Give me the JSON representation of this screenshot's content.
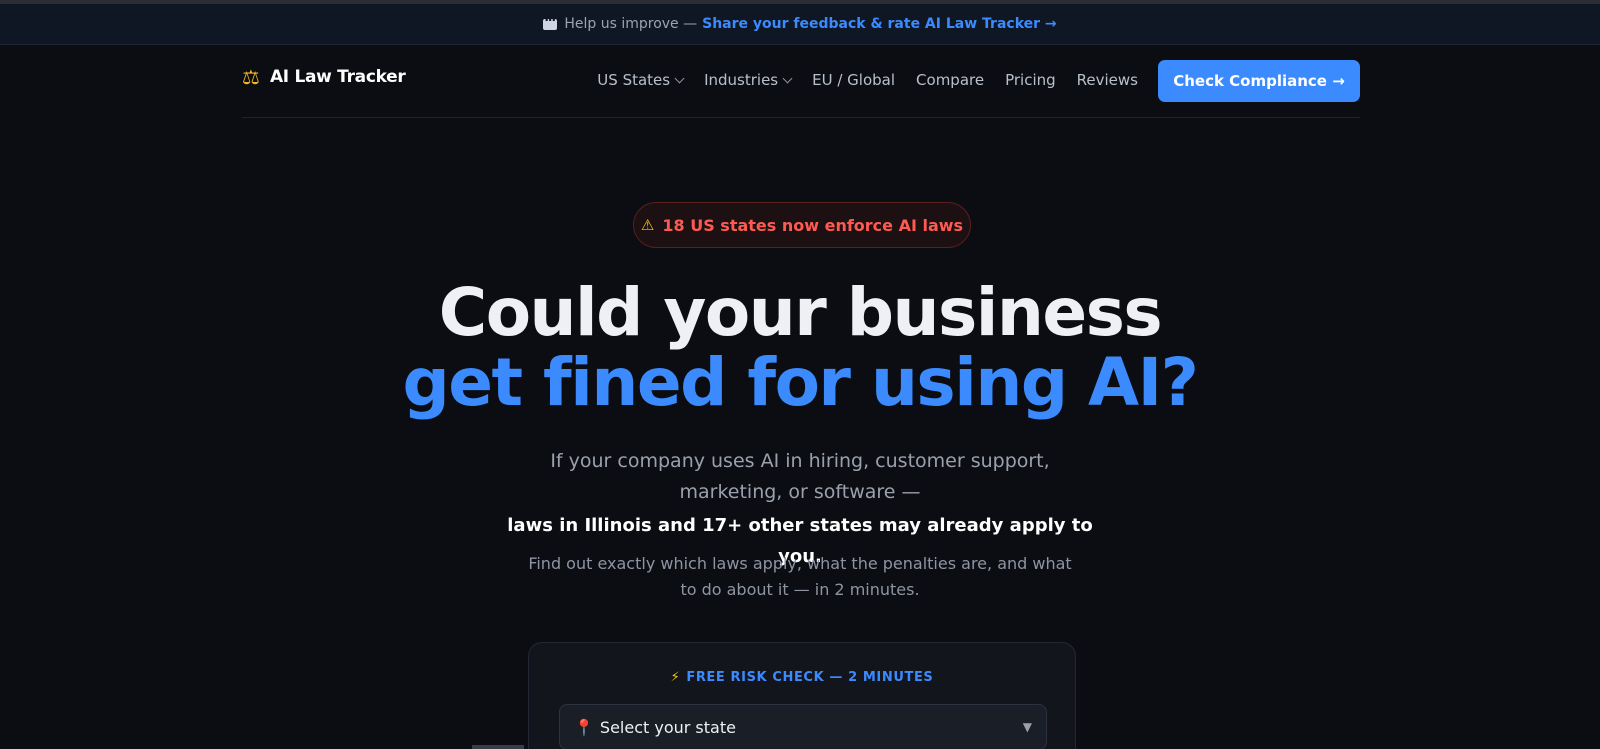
{
  "banner": {
    "prefix": "Help us improve —",
    "link": "Share your feedback & rate AI Law Tracker →",
    "icon": "chat-bubble-icon"
  },
  "brand": {
    "name": "AI Law Tracker",
    "icon": "scales-icon"
  },
  "nav": {
    "items": [
      {
        "label": "US States",
        "has_dropdown": true
      },
      {
        "label": "Industries",
        "has_dropdown": true
      },
      {
        "label": "EU / Global",
        "has_dropdown": false
      },
      {
        "label": "Compare",
        "has_dropdown": false
      },
      {
        "label": "Pricing",
        "has_dropdown": false
      },
      {
        "label": "Reviews",
        "has_dropdown": false
      }
    ],
    "cta": "Check Compliance →"
  },
  "hero": {
    "alert": "18 US states now enforce AI laws",
    "headline_line1": "Could your business",
    "headline_line2": "get fined for using AI?",
    "sub_line1": "If your company uses AI in hiring, customer support, marketing, or software —",
    "sub_bold": "laws in Illinois and 17+ other states may already apply to you.",
    "sub2": "Find out exactly which laws apply, what the penalties are, and what to do about it — in 2 minutes."
  },
  "risk_check": {
    "kicker": "FREE RISK CHECK — 2 MINUTES",
    "select_value": "Select your state"
  },
  "colors": {
    "accent": "#3b8bff",
    "alert": "#ff5a52",
    "background": "#0b0d12"
  }
}
